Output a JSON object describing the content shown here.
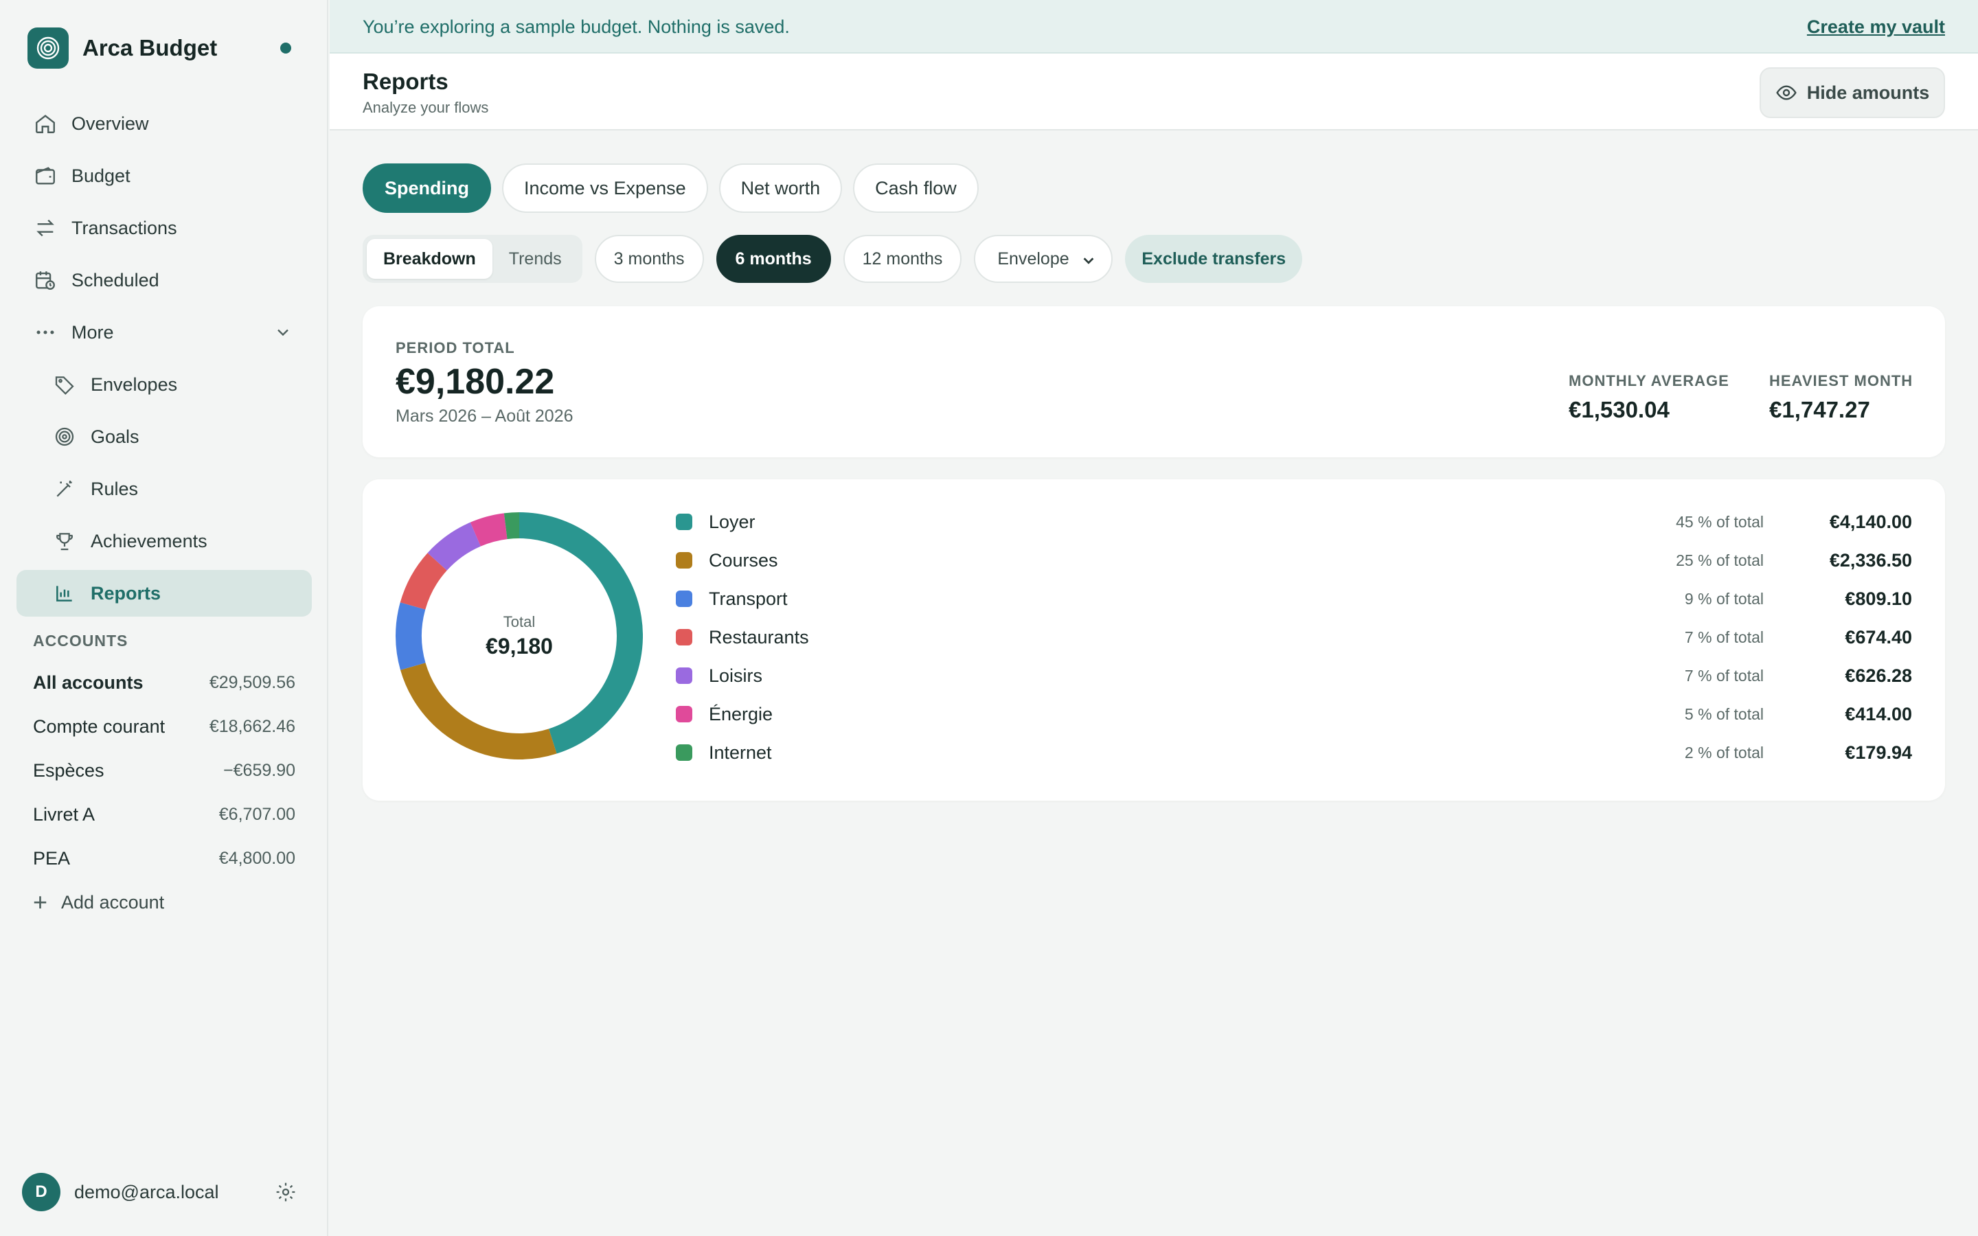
{
  "app": {
    "name": "Arca Budget"
  },
  "nav": {
    "overview": "Overview",
    "budget": "Budget",
    "transactions": "Transactions",
    "scheduled": "Scheduled",
    "more": "More",
    "envelopes": "Envelopes",
    "goals": "Goals",
    "rules": "Rules",
    "achievements": "Achievements",
    "reports": "Reports"
  },
  "accounts": {
    "heading": "ACCOUNTS",
    "items": [
      {
        "name": "All accounts",
        "amount": "€29,509.56"
      },
      {
        "name": "Compte courant",
        "amount": "€18,662.46"
      },
      {
        "name": "Espèces",
        "amount": "−€659.90"
      },
      {
        "name": "Livret A",
        "amount": "€6,707.00"
      },
      {
        "name": "PEA",
        "amount": "€4,800.00"
      }
    ],
    "add_label": "Add account"
  },
  "user": {
    "initial": "D",
    "email": "demo@arca.local"
  },
  "banner": {
    "text": "You’re exploring a sample budget. Nothing is saved.",
    "link": "Create my vault"
  },
  "header": {
    "title": "Reports",
    "subtitle": "Analyze your flows",
    "hide_label": "Hide amounts"
  },
  "tabs": [
    "Spending",
    "Income vs Expense",
    "Net worth",
    "Cash flow"
  ],
  "filters": {
    "view_options": [
      "Breakdown",
      "Trends"
    ],
    "ranges": [
      "3 months",
      "6 months",
      "12 months"
    ],
    "group_by": "Envelope",
    "exclude": "Exclude transfers"
  },
  "summary": {
    "period_label": "PERIOD TOTAL",
    "period_total": "€9,180.22",
    "period_range": "Mars 2026 – Août 2026",
    "monthly_label": "MONTHLY AVERAGE",
    "monthly_value": "€1,530.04",
    "heaviest_label": "HEAVIEST MONTH",
    "heaviest_value": "€1,747.27"
  },
  "breakdown": {
    "center_label": "Total",
    "center_value": "€9,180",
    "rows": [
      {
        "name": "Loyer",
        "pct": "45 % of total",
        "amount": "€4,140.00"
      },
      {
        "name": "Courses",
        "pct": "25 % of total",
        "amount": "€2,336.50"
      },
      {
        "name": "Transport",
        "pct": "9 % of total",
        "amount": "€809.10"
      },
      {
        "name": "Restaurants",
        "pct": "7 % of total",
        "amount": "€674.40"
      },
      {
        "name": "Loisirs",
        "pct": "7 % of total",
        "amount": "€626.28"
      },
      {
        "name": "Énergie",
        "pct": "5 % of total",
        "amount": "€414.00"
      },
      {
        "name": "Internet",
        "pct": "2 % of total",
        "amount": "€179.94"
      }
    ]
  },
  "chart_data": {
    "type": "pie",
    "categories": [
      "Loyer",
      "Courses",
      "Transport",
      "Restaurants",
      "Loisirs",
      "Énergie",
      "Internet"
    ],
    "values": [
      4140.0,
      2336.5,
      809.1,
      674.4,
      626.28,
      414.0,
      179.94
    ],
    "colors": [
      "#2a9690",
      "#b07d1b",
      "#4a80e0",
      "#e05a5a",
      "#9a6ae0",
      "#e04a9a",
      "#3a9a5e"
    ]
  },
  "colors": {
    "accent": "#1f6e68",
    "active_tab": "#1f7a72",
    "dark_pill": "#163330"
  }
}
